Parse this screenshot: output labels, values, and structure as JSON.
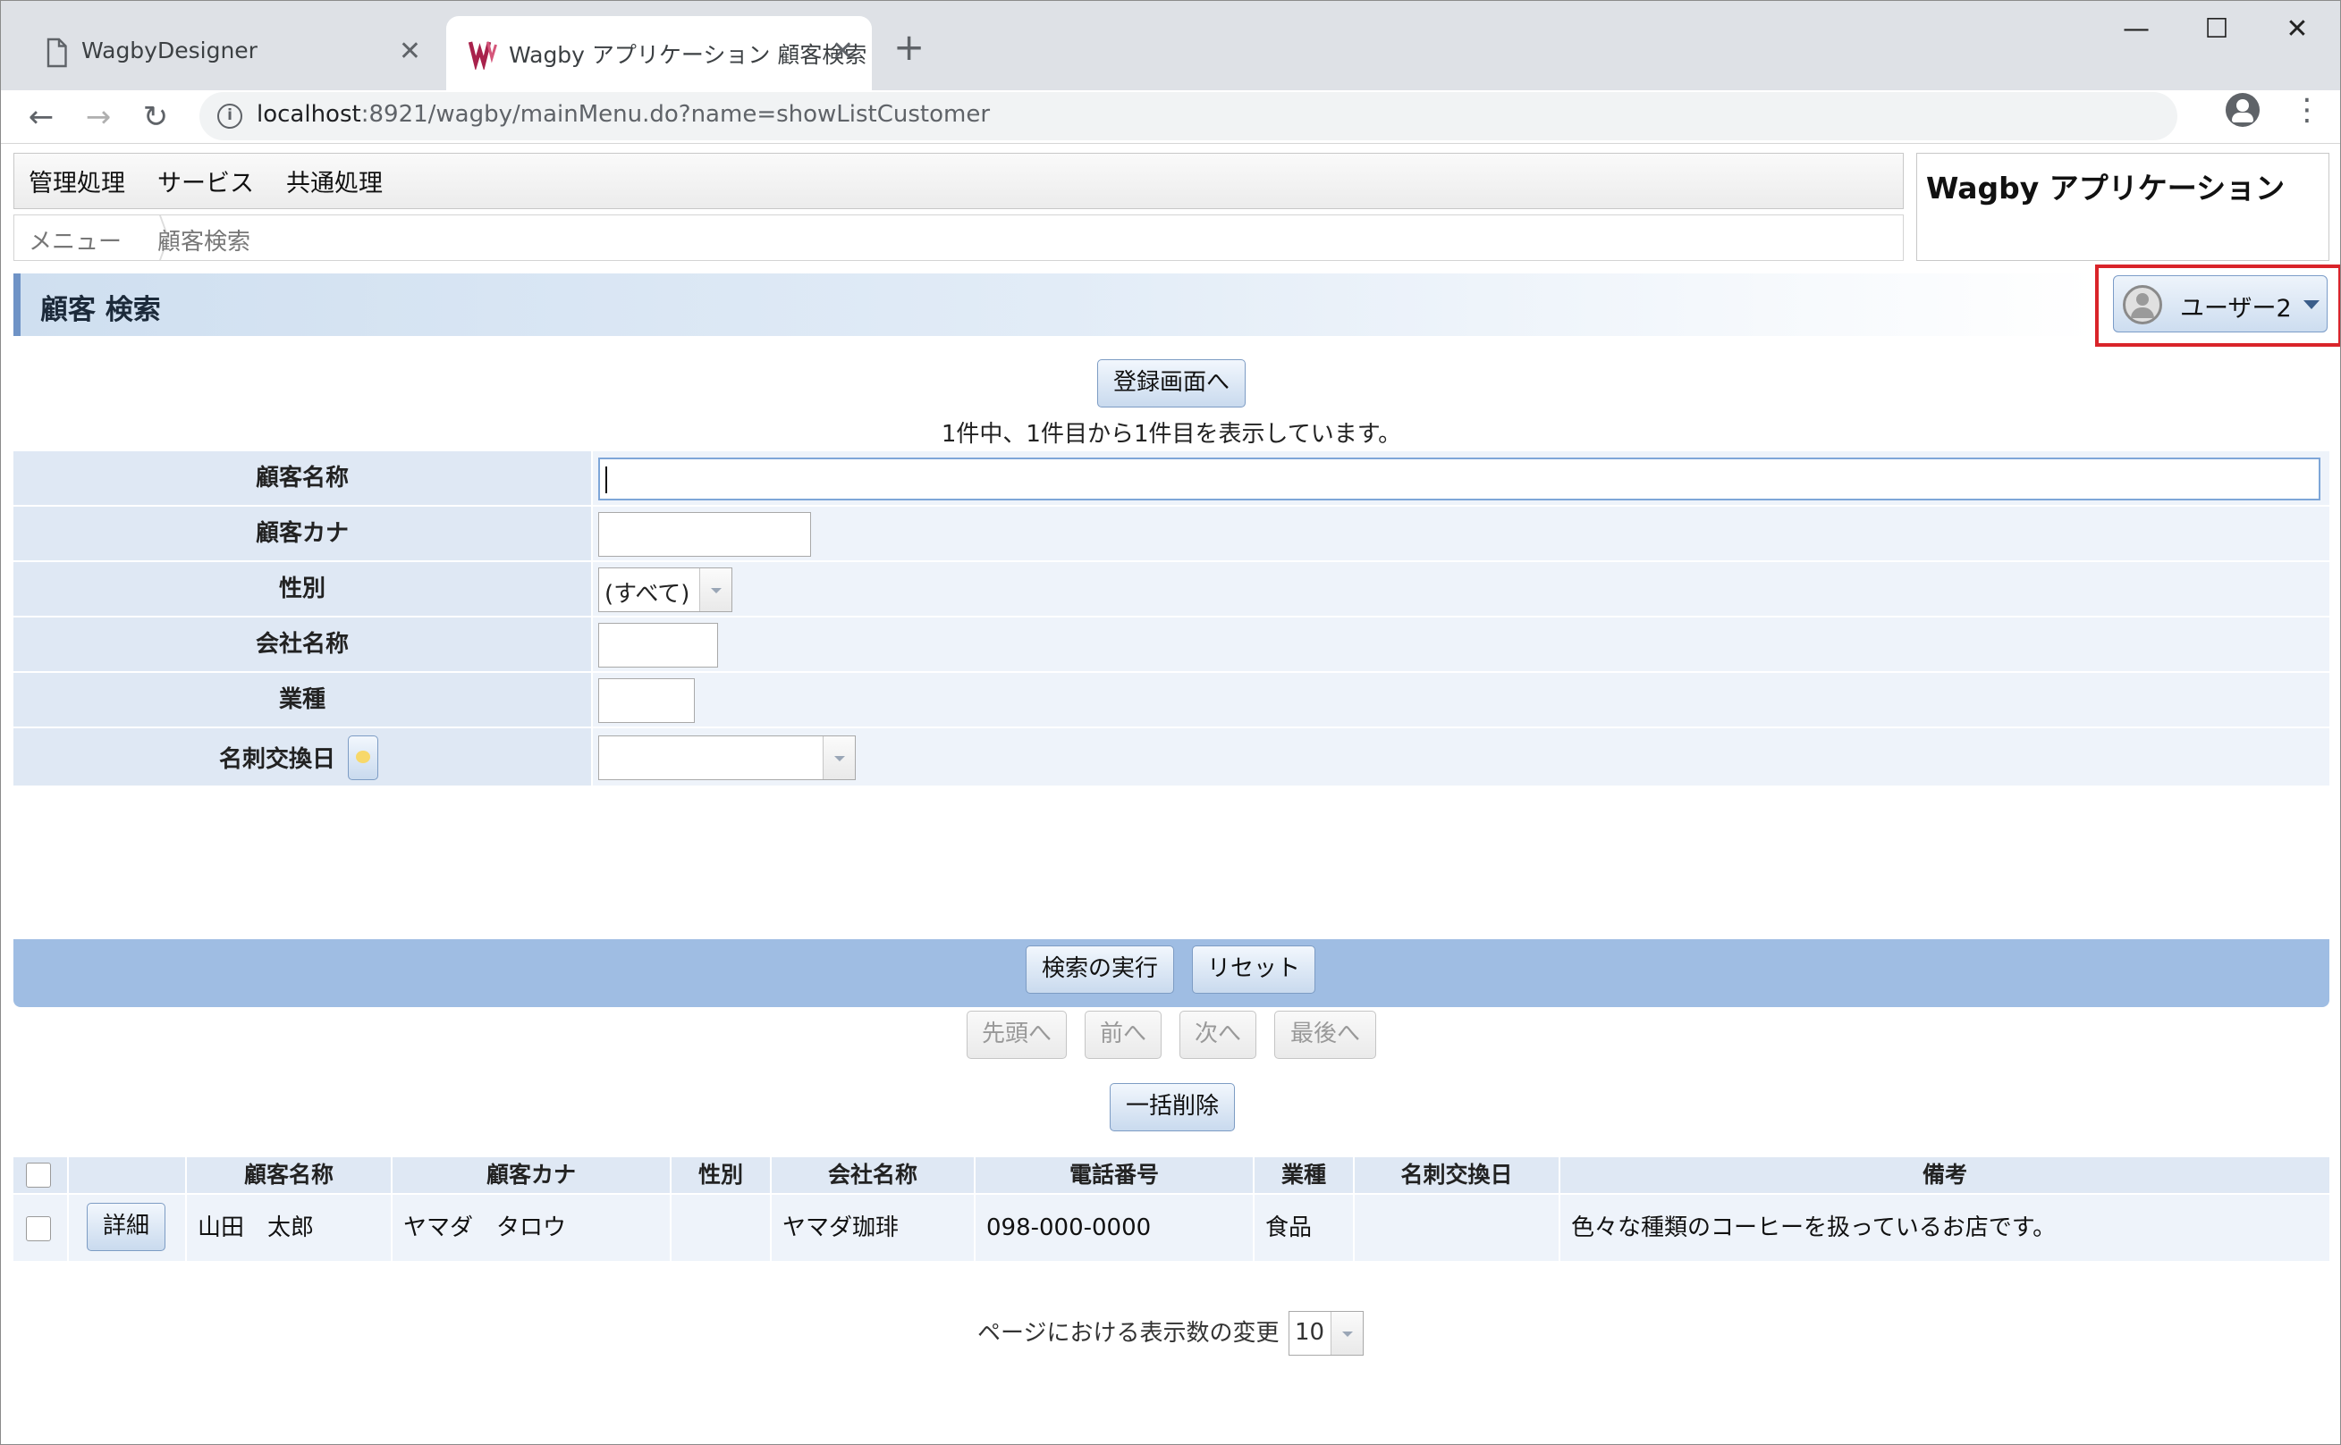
{
  "browser": {
    "tabs": [
      {
        "title": "WagbyDesigner",
        "icon": "document-icon"
      },
      {
        "title": "Wagby アプリケーション 顧客検索",
        "icon": "wagby-logo-icon"
      }
    ],
    "url_host": "localhost",
    "url_rest": ":8921/wagby/mainMenu.do?name=showListCustomer"
  },
  "menu": {
    "items": [
      "管理処理",
      "サービス",
      "共通処理"
    ]
  },
  "breadcrumb": [
    "メニュー",
    "顧客検索"
  ],
  "app_title": "Wagby アプリケーション",
  "page_title": "顧客 検索",
  "user": {
    "name": "ユーザー2"
  },
  "buttons": {
    "register": "登録画面へ",
    "search": "検索の実行",
    "reset": "リセット",
    "first": "先頭へ",
    "prev": "前へ",
    "next": "次へ",
    "last": "最後へ",
    "bulk_delete": "一括削除",
    "detail": "詳細"
  },
  "result_count_text": "1件中、1件目から1件目を表示しています。",
  "form": {
    "fields": [
      {
        "label": "顧客名称",
        "value": ""
      },
      {
        "label": "顧客カナ",
        "value": ""
      },
      {
        "label": "性別",
        "value": "(すべて)"
      },
      {
        "label": "会社名称",
        "value": ""
      },
      {
        "label": "業種",
        "value": ""
      },
      {
        "label": "名刺交換日",
        "value": ""
      }
    ]
  },
  "table": {
    "headers": [
      "顧客名称",
      "顧客カナ",
      "性別",
      "会社名称",
      "電話番号",
      "業種",
      "名刺交換日",
      "備考"
    ],
    "rows": [
      [
        "山田　太郎",
        "ヤマダ　タロウ",
        "",
        "ヤマダ珈琲",
        "098-000-0000",
        "食品",
        "",
        "色々な種類のコーヒーを扱っているお店です。"
      ]
    ]
  },
  "page_size": {
    "label": "ページにおける表示数の変更",
    "value": "10"
  },
  "colors": {
    "accent": "#6f93c6",
    "header_bg": "#dfe8f4",
    "highlight": "#d9242a"
  }
}
